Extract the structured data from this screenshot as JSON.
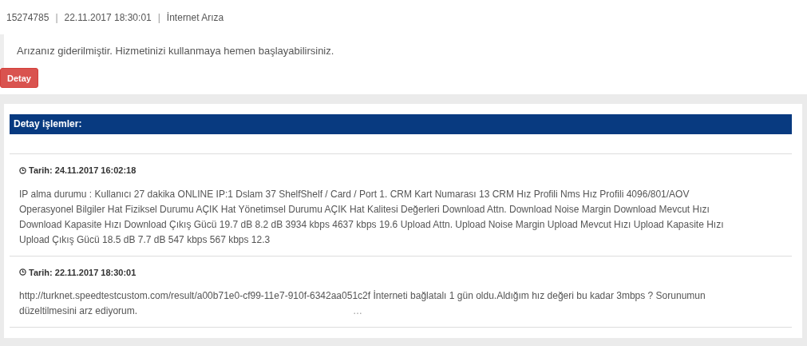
{
  "header": {
    "id": "15274785",
    "date": "22.11.2017 18:30:01",
    "type": "İnternet Arıza",
    "separators": [
      "|",
      "|"
    ]
  },
  "message": "Arızanız giderilmiştir. Hizmetinizi kullanmaya hemen başlayabilirsiniz.",
  "detail_button": "Detay",
  "details": {
    "title": "Detay işlemler:",
    "entries": [
      {
        "date": "Tarih: 24.11.2017 16:02:18",
        "text": "IP alma durumu : Kullanıcı 27 dakika ONLINE IP:1 Dslam 37 ShelfShelf / Card / Port 1. CRM Kart Numarası 13 CRM Hız Profili Nms Hız Profili 4096/801/AOV Operasyonel Bilgiler Hat Fiziksel Durumu AÇIK Hat Yönetimsel Durumu AÇIK Hat Kalitesi Değerleri Download Attn. Download Noise Margin Download Mevcut Hızı Download Kapasite Hızı Download Çıkış Gücü 19.7 dB 8.2 dB 3934 kbps 4637 kbps 19.6 Upload Attn. Upload Noise Margin Upload Mevcut Hızı Upload Kapasite Hızı Upload Çıkış Gücü 18.5 dB 7.7 dB 547 kbps 567 kbps 12.3"
      },
      {
        "date": "Tarih: 22.11.2017 18:30:01",
        "text": "http://turknet.speedtestcustom.com/result/a00b71e0-cf99-11e7-910f-6342aa051c2f İnterneti bağlatalı 1 gün oldu.Aldığım hız değeri bu kadar 3mbps ? Sorunumun düzeltilmesini arz ediyorum.",
        "trailing": "…"
      }
    ]
  }
}
